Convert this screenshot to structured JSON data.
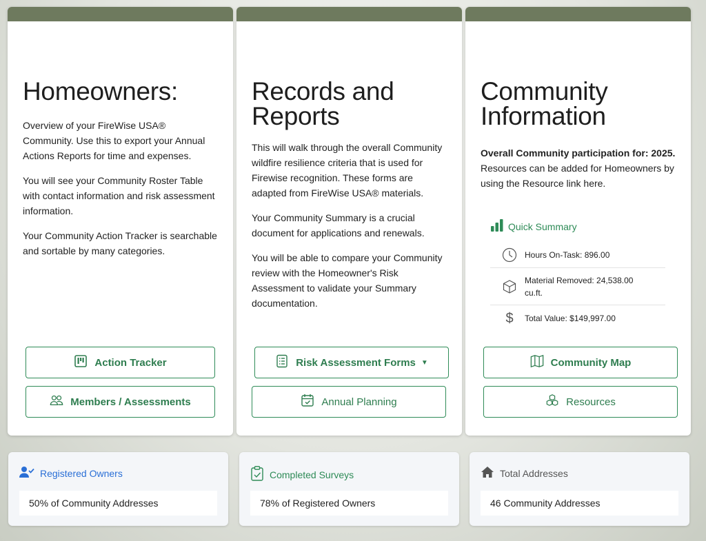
{
  "cards": {
    "homeowners": {
      "title": "Homeowners:",
      "paragraphs": [
        "Overview of your FireWise USA® Community. Use this to export your Annual Actions Reports for time and expenses.",
        "You will see your Community Roster Table with contact information and risk assessment information.",
        "Your Community Action Tracker is searchable and sortable by many categories."
      ],
      "buttons": {
        "action_tracker": "Action Tracker",
        "members": "Members / Assessments"
      }
    },
    "records": {
      "title_line1": "Records and",
      "title_line2": "Reports",
      "paragraphs": [
        "This will walk through the overall Community wildfire resilience criteria that is used for Firewise recognition. These forms are adapted from FireWise USA® materials.",
        "Your Community Summary is a crucial document for applications and renewals.",
        "You will be able to compare your Community review with the Homeowner's Risk Assessment to validate your Summary documentation."
      ],
      "buttons": {
        "risk_forms": "Risk Assessment Forms",
        "annual_planning": "Annual Planning"
      }
    },
    "community": {
      "title_line1": "Community",
      "title_line2": "Information",
      "intro_bold": "Overall Community participation for: 2025.",
      "intro_rest": " Resources can be added for Homeowners by using the Resource link here.",
      "quick_summary": {
        "title": "Quick Summary",
        "hours": "Hours On-Task: 896.00",
        "material": "Material Removed: 24,538.00 cu.ft.",
        "value": "Total Value: $149,997.00"
      },
      "buttons": {
        "community_map": "Community Map",
        "resources": "Resources"
      }
    }
  },
  "stats": {
    "registered": {
      "label": "Registered Owners",
      "value": "50% of Community Addresses",
      "color": "#2a6fd6"
    },
    "surveys": {
      "label": "Completed Surveys",
      "value": "78% of Registered Owners",
      "color": "#2e8b57"
    },
    "addresses": {
      "label": "Total Addresses",
      "value": "46 Community Addresses",
      "color": "#555555"
    }
  },
  "colors": {
    "header_bar": "#6e7a5e",
    "accent_green": "#2e8b57",
    "accent_blue": "#2a6fd6"
  }
}
